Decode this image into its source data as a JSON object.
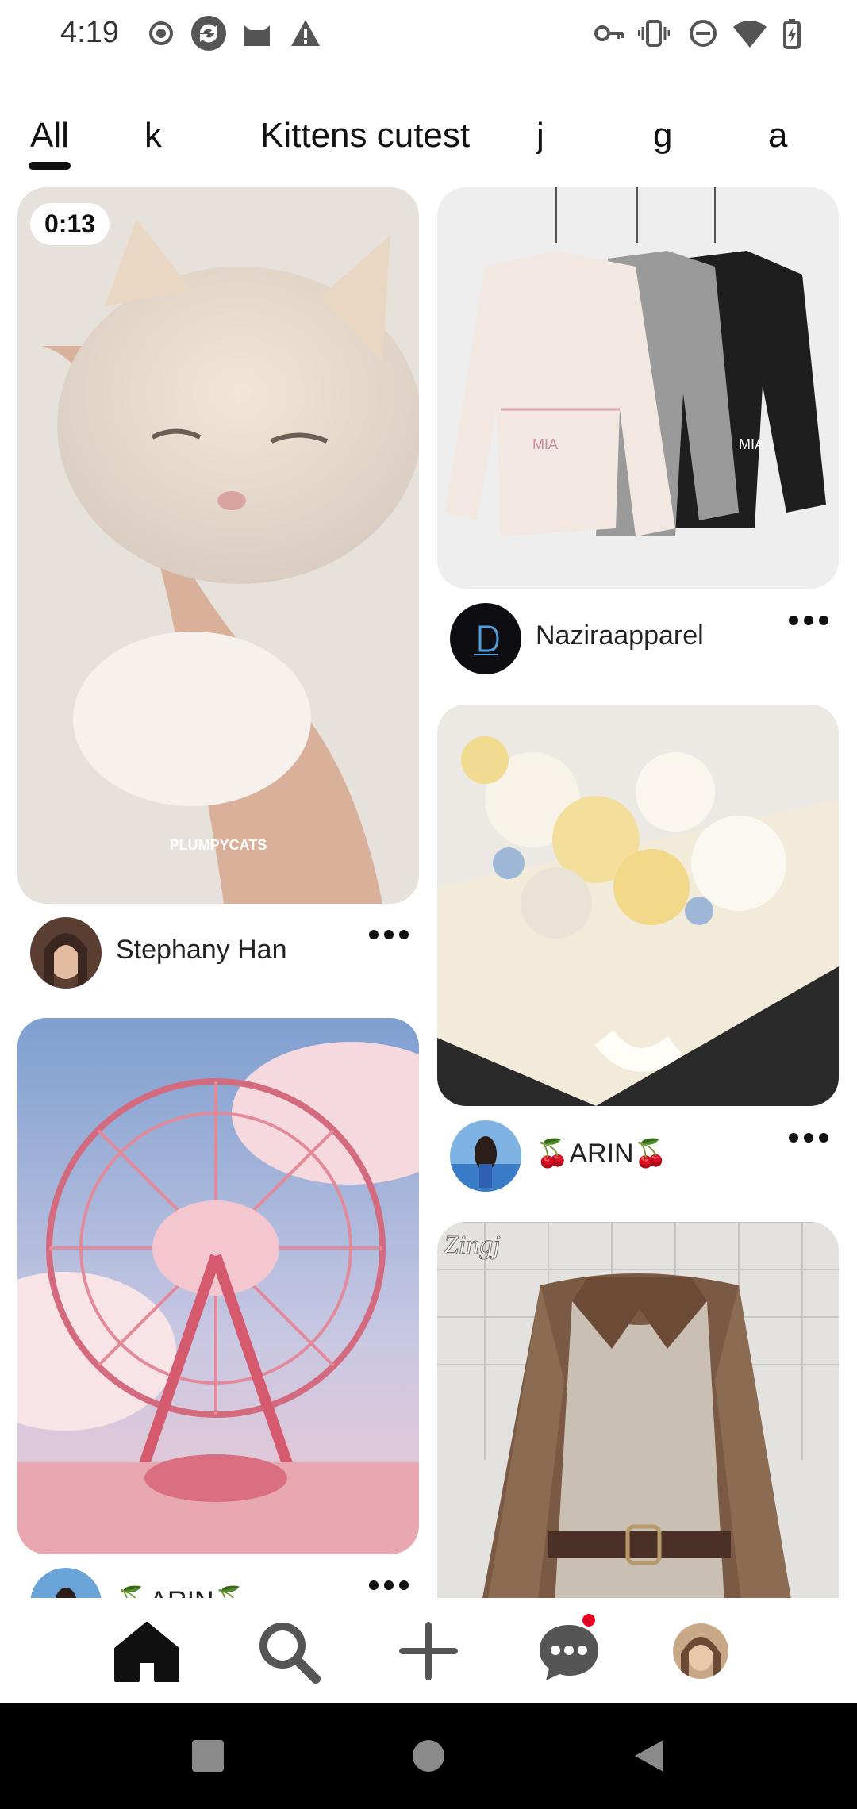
{
  "status_bar": {
    "time": "4:19",
    "left_icons": [
      "record-icon",
      "sync-icon",
      "cat-app-icon",
      "warning-icon"
    ],
    "right_icons": [
      "vpn-key-icon",
      "vibrate-icon",
      "do-not-disturb-icon",
      "wifi-icon",
      "battery-icon"
    ]
  },
  "tabs": [
    {
      "label": "All",
      "active": true
    },
    {
      "label": "k"
    },
    {
      "label": "Kittens cutest"
    },
    {
      "label": "j"
    },
    {
      "label": "g"
    },
    {
      "label": "a"
    }
  ],
  "pins": [
    {
      "author": "Stephany Han",
      "video_duration": "0:13",
      "watermark": "PLUMPYCATS"
    },
    {
      "author": "Naziraapparel"
    },
    {
      "author": "🍒ARIN🍒"
    },
    {
      "author": "🍒ARIN🍒"
    },
    {
      "watermark": "Zingj"
    }
  ],
  "bottom_nav": {
    "items": [
      "home-icon",
      "search-icon",
      "create-icon",
      "messages-icon",
      "profile-avatar"
    ],
    "notification_dot_color": "#e60023"
  },
  "colors": {
    "text": "#111111",
    "accent": "#e60023"
  }
}
